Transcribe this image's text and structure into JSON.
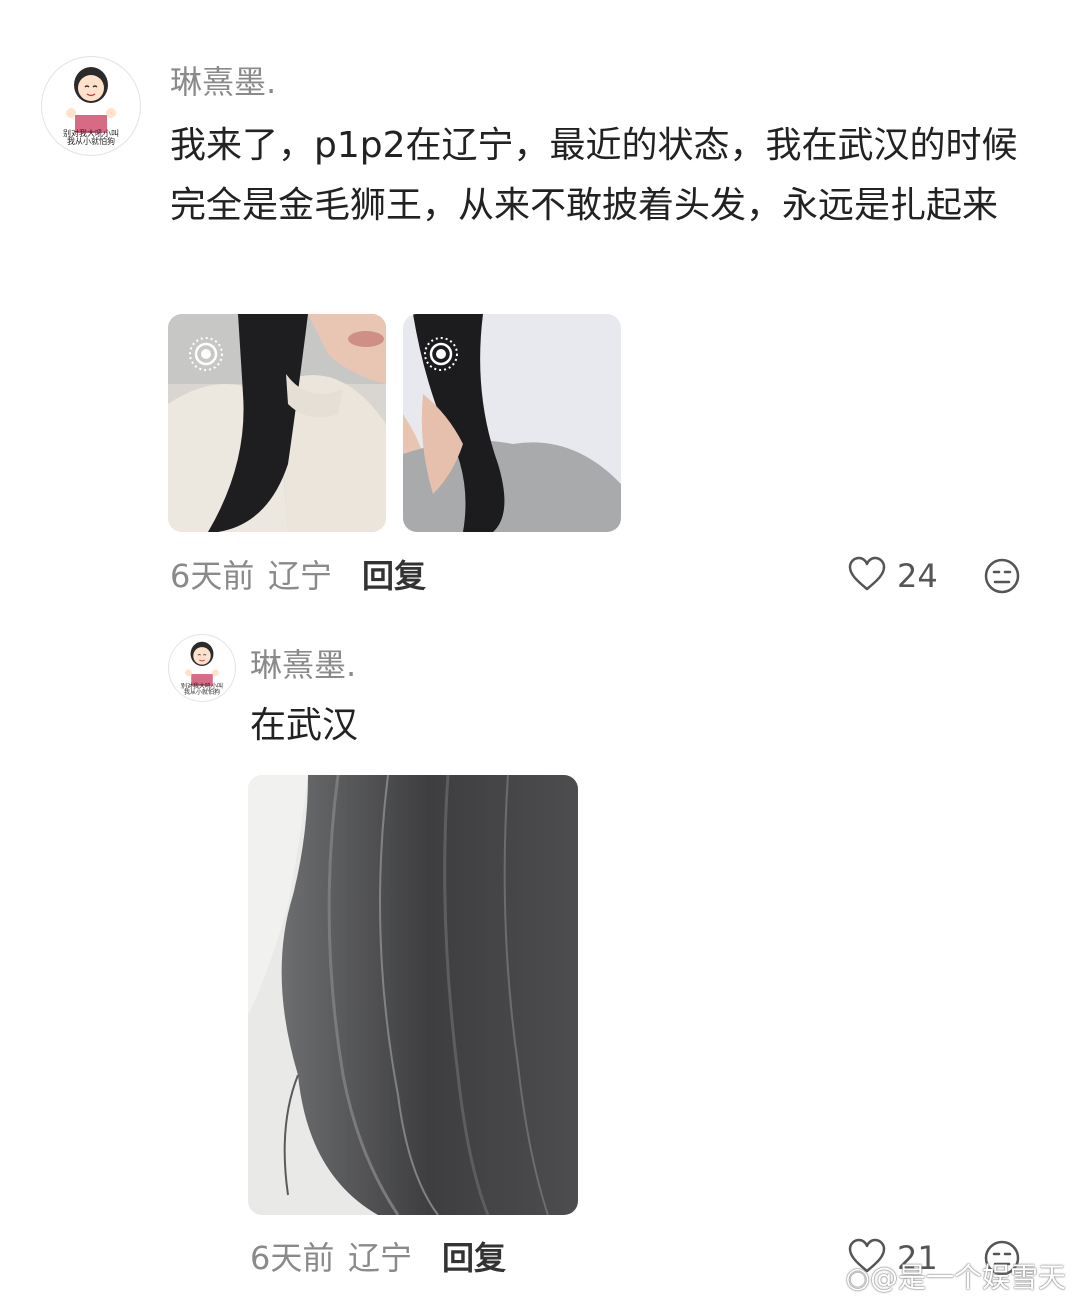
{
  "comment": {
    "username": "琳熹墨.",
    "avatar_caption_line1": "别对我大吼小叫",
    "avatar_caption_line2": "我从小就怕狗",
    "text": "我来了，p1p2在辽宁，最近的状态，我在武汉的时候完全是金毛狮王，从来不敢披着头发，永远是扎起来",
    "images": [
      {
        "icon": "live-photo-icon",
        "subject": "woman-white-sweater-long-black-hair"
      },
      {
        "icon": "live-photo-icon",
        "subject": "long-black-hair-grey-shirt"
      }
    ],
    "time": "6天前",
    "location": "辽宁",
    "reply_label": "回复",
    "like_count": "24",
    "like_icon": "heart-outline-icon",
    "react_icon": "neutral-face-icon"
  },
  "reply": {
    "username": "琳熹墨.",
    "avatar_caption_line1": "别对我大吼小叫",
    "avatar_caption_line2": "我从小就怕狗",
    "text": "在武汉",
    "image": {
      "subject": "frizzy-dark-hair"
    },
    "time": "6天前",
    "location": "辽宁",
    "reply_label": "回复",
    "like_count": "21",
    "like_icon": "heart-outline-icon",
    "react_icon": "neutral-face-icon"
  },
  "watermark": {
    "icon": "weibo-logo-icon",
    "text": "@是一个娱雪天"
  }
}
